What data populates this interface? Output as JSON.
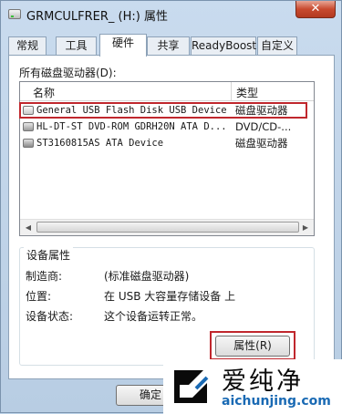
{
  "window": {
    "title": "GRMCULFRER_ (H:) 属性",
    "close_label": "✕"
  },
  "tabs": [
    {
      "label": "常规",
      "active": false
    },
    {
      "label": "工具",
      "active": false
    },
    {
      "label": "硬件",
      "active": true
    },
    {
      "label": "共享",
      "active": false
    },
    {
      "label": "ReadyBoost",
      "active": false
    },
    {
      "label": "自定义",
      "active": false
    }
  ],
  "hardware": {
    "all_drives_label": "所有磁盘驱动器(D):",
    "columns": {
      "name": "名称",
      "type": "类型"
    },
    "devices": [
      {
        "name": "General USB Flash Disk USB Device",
        "type": "磁盘驱动器",
        "icon": "usb-drive-icon",
        "highlighted": true
      },
      {
        "name": "HL-DT-ST DVD-ROM GDRH20N ATA D...",
        "type": "DVD/CD-...",
        "icon": "dvd-drive-icon",
        "highlighted": false
      },
      {
        "name": "ST3160815AS ATA Device",
        "type": "磁盘驱动器",
        "icon": "hard-disk-icon",
        "highlighted": false
      }
    ]
  },
  "device_properties": {
    "group_title": "设备属性",
    "manufacturer_label": "制造商:",
    "manufacturer_value": "(标准磁盘驱动器)",
    "location_label": "位置:",
    "location_value": "在 USB 大容量存储设备 上",
    "status_label": "设备状态:",
    "status_value": "这个设备运转正常。",
    "properties_button": "属性(R)"
  },
  "footer": {
    "ok_button": "确定"
  },
  "watermark": {
    "cn_text": "爱纯净",
    "en_text": "aichunjing.com"
  },
  "colors": {
    "highlight_red": "#c0272d",
    "watermark_blue": "#1a6ab4"
  }
}
